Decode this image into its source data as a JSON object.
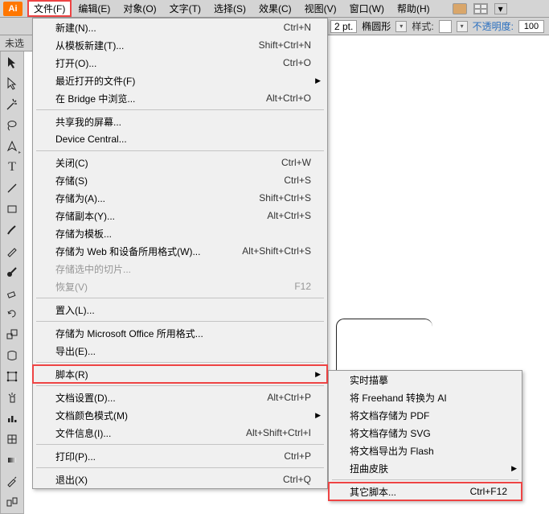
{
  "menubar": {
    "items": [
      "文件(F)",
      "编辑(E)",
      "对象(O)",
      "文字(T)",
      "选择(S)",
      "效果(C)",
      "视图(V)",
      "窗口(W)",
      "帮助(H)"
    ],
    "active_index": 0
  },
  "tab": {
    "label": "未选"
  },
  "toolbar": {
    "stroke_value": "2 pt.",
    "brush_name": "椭圆形",
    "style_label": "样式:",
    "opacity_label": "不透明度:",
    "opacity_value": "100"
  },
  "file_menu": [
    {
      "label": "新建(N)...",
      "short": "Ctrl+N"
    },
    {
      "label": "从模板新建(T)...",
      "short": "Shift+Ctrl+N"
    },
    {
      "label": "打开(O)...",
      "short": "Ctrl+O"
    },
    {
      "label": "最近打开的文件(F)",
      "short": "",
      "arrow": true
    },
    {
      "label": "在 Bridge 中浏览...",
      "short": "Alt+Ctrl+O"
    },
    {
      "sep": true
    },
    {
      "label": "共享我的屏幕...",
      "short": ""
    },
    {
      "label": "Device Central...",
      "short": ""
    },
    {
      "sep": true
    },
    {
      "label": "关闭(C)",
      "short": "Ctrl+W"
    },
    {
      "label": "存储(S)",
      "short": "Ctrl+S"
    },
    {
      "label": "存储为(A)...",
      "short": "Shift+Ctrl+S"
    },
    {
      "label": "存储副本(Y)...",
      "short": "Alt+Ctrl+S"
    },
    {
      "label": "存储为模板...",
      "short": ""
    },
    {
      "label": "存储为 Web 和设备所用格式(W)...",
      "short": "Alt+Shift+Ctrl+S"
    },
    {
      "label": "存储选中的切片...",
      "short": "",
      "disabled": true
    },
    {
      "label": "恢复(V)",
      "short": "F12",
      "disabled": true
    },
    {
      "sep": true
    },
    {
      "label": "置入(L)...",
      "short": ""
    },
    {
      "sep": true
    },
    {
      "label": "存储为 Microsoft Office 所用格式...",
      "short": ""
    },
    {
      "label": "导出(E)...",
      "short": ""
    },
    {
      "sep": true
    },
    {
      "label": "脚本(R)",
      "short": "",
      "arrow": true,
      "hl": true
    },
    {
      "sep": true
    },
    {
      "label": "文档设置(D)...",
      "short": "Alt+Ctrl+P"
    },
    {
      "label": "文档颜色模式(M)",
      "short": "",
      "arrow": true
    },
    {
      "label": "文件信息(I)...",
      "short": "Alt+Shift+Ctrl+I"
    },
    {
      "sep": true
    },
    {
      "label": "打印(P)...",
      "short": "Ctrl+P"
    },
    {
      "sep": true
    },
    {
      "label": "退出(X)",
      "short": "Ctrl+Q"
    }
  ],
  "script_submenu": [
    {
      "label": "实时描摹",
      "short": ""
    },
    {
      "label": "将 Freehand 转换为 AI",
      "short": ""
    },
    {
      "label": "将文档存储为 PDF",
      "short": ""
    },
    {
      "label": "将文档存储为 SVG",
      "short": ""
    },
    {
      "label": "将文档导出为 Flash",
      "short": ""
    },
    {
      "label": "扭曲皮肤",
      "short": "",
      "arrow": true
    },
    {
      "sep": true
    },
    {
      "label": "其它脚本...",
      "short": "Ctrl+F12",
      "hl": true
    }
  ]
}
